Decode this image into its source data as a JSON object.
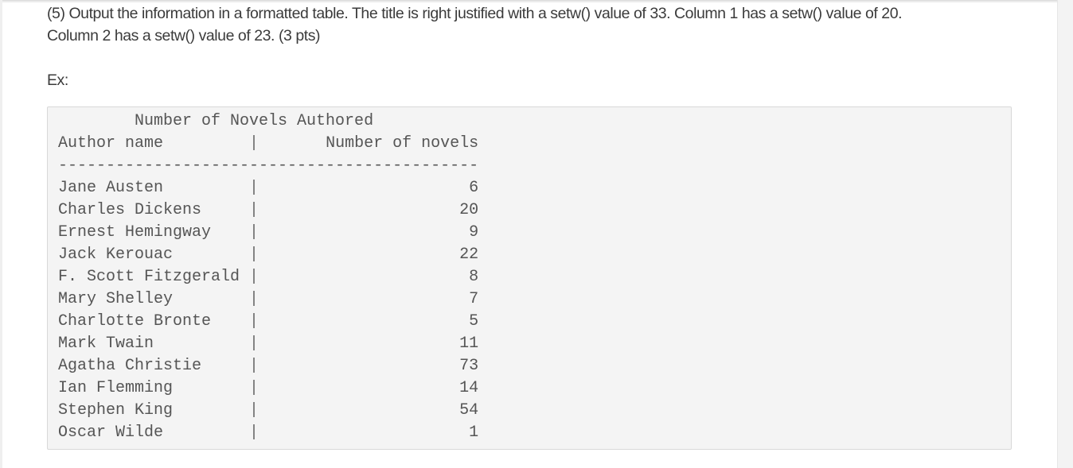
{
  "question": {
    "line1": "(5) Output the information in a formatted table. The title is right justified with a setw() value of 33. Column 1 has a setw() value of 20.",
    "line2": "Column 2 has a setw() value of 23. (3 pts)"
  },
  "example_label": "Ex:",
  "output": {
    "title": "Number of Novels Authored",
    "title_width": 33,
    "col1_width": 20,
    "col2_width": 23,
    "header": {
      "col1": "Author name",
      "separator": "|",
      "col2": "Number of novels"
    },
    "divider_char": "-",
    "divider_length": 44,
    "rows": [
      {
        "author": "Jane Austen",
        "novels": "6"
      },
      {
        "author": "Charles Dickens",
        "novels": "20"
      },
      {
        "author": "Ernest Hemingway",
        "novels": "9"
      },
      {
        "author": "Jack Kerouac",
        "novels": "22"
      },
      {
        "author": "F. Scott Fitzgerald",
        "novels": "8"
      },
      {
        "author": "Mary Shelley",
        "novels": "7"
      },
      {
        "author": "Charlotte Bronte",
        "novels": "5"
      },
      {
        "author": "Mark Twain",
        "novels": "11"
      },
      {
        "author": "Agatha Christie",
        "novels": "73"
      },
      {
        "author": "Ian Flemming",
        "novels": "14"
      },
      {
        "author": "Stephen King",
        "novels": "54"
      },
      {
        "author": "Oscar Wilde",
        "novels": "1"
      }
    ]
  },
  "colors": {
    "text": "#3b3b3b",
    "code_text": "#555555",
    "code_background": "#f4f4f4",
    "code_border": "#d8d8d8"
  }
}
